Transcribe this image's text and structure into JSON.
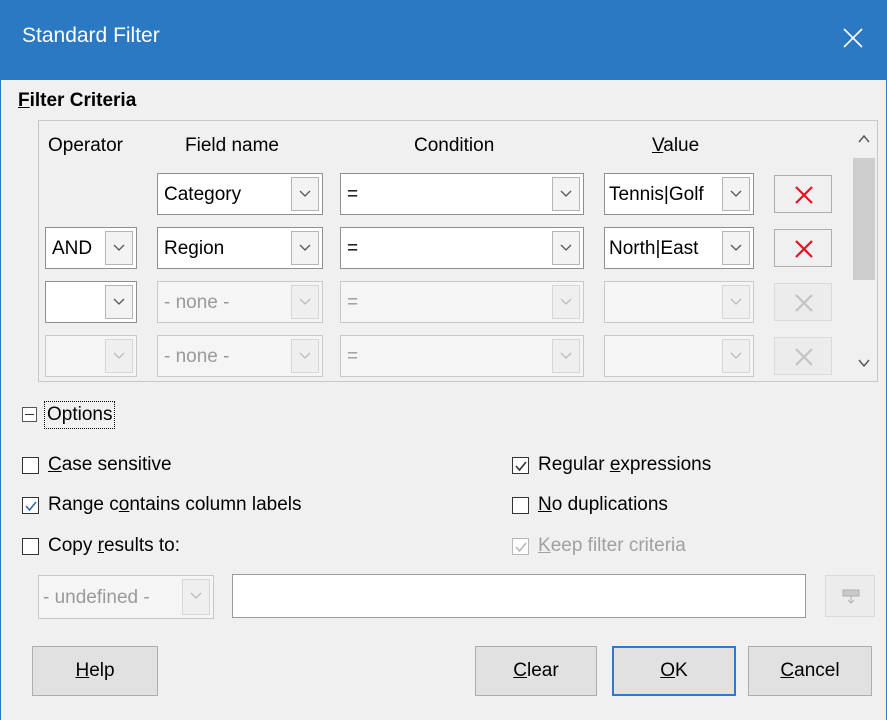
{
  "window": {
    "title": "Standard Filter"
  },
  "criteria": {
    "heading_mnemonic": "F",
    "heading_rest": "ilter Criteria",
    "columns": {
      "operator": "Operator",
      "field": "Field name",
      "condition": "Condition",
      "value_mnemonic": "V",
      "value_rest": "alue"
    },
    "rows": [
      {
        "operator": "",
        "field": "Category",
        "condition": "=",
        "value": "Tennis|Golf",
        "enabled": true
      },
      {
        "operator": "AND",
        "field": "Region",
        "condition": "=",
        "value": "North|East",
        "enabled": true
      },
      {
        "operator": "",
        "field": "- none -",
        "condition": "=",
        "value": "",
        "enabled": false
      },
      {
        "operator": "",
        "field": "- none -",
        "condition": "=",
        "value": "",
        "enabled": false
      }
    ]
  },
  "options": {
    "label": "Options",
    "case_sensitive": {
      "mnemonic": "C",
      "rest": "ase sensitive",
      "checked": false
    },
    "range_labels": {
      "pre": "Range c",
      "mnemonic": "o",
      "rest": "ntains column labels",
      "checked": true
    },
    "copy_results": {
      "pre": "Copy ",
      "mnemonic": "r",
      "rest": "esults to:",
      "checked": false
    },
    "regular_expressions": {
      "pre": "Regular ",
      "mnemonic": "e",
      "rest": "xpressions",
      "checked": true
    },
    "no_duplications": {
      "mnemonic": "N",
      "rest": "o duplications",
      "checked": false
    },
    "keep_filter": {
      "mnemonic": "K",
      "rest": "eep filter criteria",
      "checked": true,
      "disabled": true
    },
    "copy_target": "- undefined -",
    "copy_target_ref": ""
  },
  "buttons": {
    "help": {
      "mnemonic": "H",
      "rest": "elp"
    },
    "clear": {
      "mnemonic": "C",
      "rest": "lear"
    },
    "ok": {
      "mnemonic": "O",
      "rest": "K"
    },
    "cancel": {
      "mnemonic": "C",
      "rest": "ancel"
    }
  },
  "colors": {
    "titlebar": "#2b79c2",
    "delete_red": "#e81123",
    "default_border": "#2f7ad0"
  }
}
